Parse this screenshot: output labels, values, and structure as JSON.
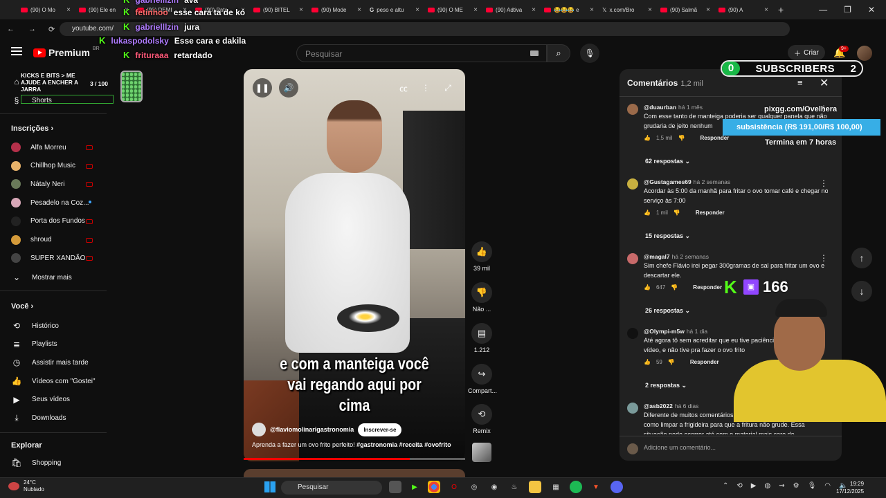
{
  "browser": {
    "tabs": [
      {
        "label": "(90) O Mo",
        "type": "yt"
      },
      {
        "label": "(90) Ele en",
        "type": "yt"
      },
      {
        "label": "(90) DEMI",
        "type": "yt"
      },
      {
        "label": "(90) Pato",
        "type": "yt"
      },
      {
        "label": "(90) BITEL",
        "type": "yt"
      },
      {
        "label": "(90) Mode",
        "type": "yt"
      },
      {
        "label": "peso e altu",
        "type": "g"
      },
      {
        "label": "(90) O ME",
        "type": "yt"
      },
      {
        "label": "(90) Adtiva",
        "type": "yt"
      },
      {
        "label": "😂😂😂 e",
        "type": "yt"
      },
      {
        "label": "x.com/Bro",
        "type": "x"
      },
      {
        "label": "(90) Salmã",
        "type": "yt"
      },
      {
        "label": "(90) A",
        "type": "yt"
      }
    ],
    "url": "youtube.com/"
  },
  "youtube": {
    "logo_text": "Premium",
    "logo_region": "BR",
    "search_placeholder": "Pesquisar",
    "create_label": "Criar",
    "notif_badge": "9+"
  },
  "sidebar": {
    "shorts_label": "Shorts",
    "subscriptions_heading": "Inscrições",
    "channels": [
      {
        "name": "Alfa Morreu",
        "color": "#b5304a",
        "live": true
      },
      {
        "name": "Chillhop Music",
        "color": "#e7b26a",
        "live": true
      },
      {
        "name": "Nátaly Neri",
        "color": "#6a7a5a",
        "live": true
      },
      {
        "name": "Pesadelo na Coz...",
        "color": "#d8a8b8",
        "live": false
      },
      {
        "name": "Porta dos Fundos",
        "color": "#222222",
        "live": true
      },
      {
        "name": "shroud",
        "color": "#d49a3a",
        "live": true
      },
      {
        "name": "SUPER XANDÃO",
        "color": "#444444",
        "live": true
      }
    ],
    "show_more": "Mostrar mais",
    "you_heading": "Você",
    "you_items": [
      {
        "label": "Histórico",
        "icon": "history-icon"
      },
      {
        "label": "Playlists",
        "icon": "playlists-icon"
      },
      {
        "label": "Assistir mais tarde",
        "icon": "watch-later-icon"
      },
      {
        "label": "Vídeos com \"Gostei\"",
        "icon": "like-icon"
      },
      {
        "label": "Seus vídeos",
        "icon": "your-videos-icon"
      },
      {
        "label": "Downloads",
        "icon": "download-icon"
      }
    ],
    "explore_heading": "Explorar",
    "explore_items": [
      {
        "label": "Shopping",
        "icon": "shopping-icon"
      }
    ]
  },
  "jar_widget": {
    "title": "KICKS E BITS > ME AJUDE A ENCHER A JARRA",
    "count": "3 / 100"
  },
  "chat": [
    {
      "user": "gabrielllzin",
      "msg": "ava",
      "color": "#b07cff"
    },
    {
      "user": "fetinhoo",
      "msg": "esse cara ta de kó",
      "color": "#ff6a6a"
    },
    {
      "user": "gabrielllzin",
      "msg": "jura",
      "color": "#b07cff"
    },
    {
      "user": "lukaspodolsky",
      "msg": "Esse cara e dakila",
      "color": "#b07cff"
    },
    {
      "user": "frituraaa",
      "msg": "retardado",
      "color": "#ff5a7a"
    }
  ],
  "video": {
    "caption": "e com a manteiga você vai regando aqui por cima",
    "channel": "@flaviomolinarigastronomia",
    "subscribe": "Inscrever-se",
    "description": "Aprenda a fazer um ovo frito perfeito!",
    "hashtags": "#gastronomia #receita #ovofrito",
    "progress": 0.75
  },
  "actions": {
    "likes": "39 mil",
    "dislike": "Não ...",
    "comments": "1.212",
    "share": "Compart...",
    "remix": "Remix"
  },
  "comments": {
    "title": "Comentários",
    "count": "1,2 mil",
    "items": [
      {
        "user": "@duaurban",
        "time": "há 1 mês",
        "text": "Com esse tanto de manteiga poderia ser qualquer panela que não grudaria de jeito nenhum",
        "likes": "1,5 mil",
        "replies": "62 respostas",
        "color": "#9a6a4a"
      },
      {
        "user": "@Gustagames69",
        "time": "há 2 semanas",
        "text": "Acordar às 5:00 da manhã para fritar o ovo tomar café e chegar no serviço às 7:00",
        "likes": "1 mil",
        "replies": "15 respostas",
        "color": "#c8b040"
      },
      {
        "user": "@magal7",
        "time": "há 2 semanas",
        "text": "Sim chefe Flávio irei pegar 300gramas de sal para fritar um ovo e descartar ele.",
        "likes": "647",
        "replies": "26 respostas",
        "color": "#c86a6a"
      },
      {
        "user": "@Olympi-m5w",
        "time": "há 1 dia",
        "text": "Até agora tô sem acreditar que eu tive paciência de ver esse vídeo, e não tive pra fazer o ovo frito",
        "likes": "59",
        "replies": "2 respostas",
        "color": "#111111"
      },
      {
        "user": "@asb2022",
        "time": "há 6 dias",
        "text": "Diferente de muitos comentários, quero agradecer por ensinar como limpar a frigideira para que a fritura não grude. Essa situação pode ocorrer até com o material mais caro de",
        "likes": "",
        "replies": "",
        "color": "#7a9a9a"
      }
    ],
    "reply_label": "Responder",
    "add_placeholder": "Adicione um comentário..."
  },
  "overlays": {
    "subs_left": "0",
    "subs_label": "SUBSCRIBERS",
    "subs_right": "2",
    "pix_url": "pixgg.com/Ovelhera",
    "goal": "subsistência (R$ 191,00/R$ 100,00)",
    "goal_end": "Termina em 7 horas",
    "viewers": "166"
  },
  "taskbar": {
    "weather_temp": "24°C",
    "weather_desc": "Nublado",
    "search": "Pesquisar",
    "time": "19:29",
    "date": "17/12/2025"
  }
}
